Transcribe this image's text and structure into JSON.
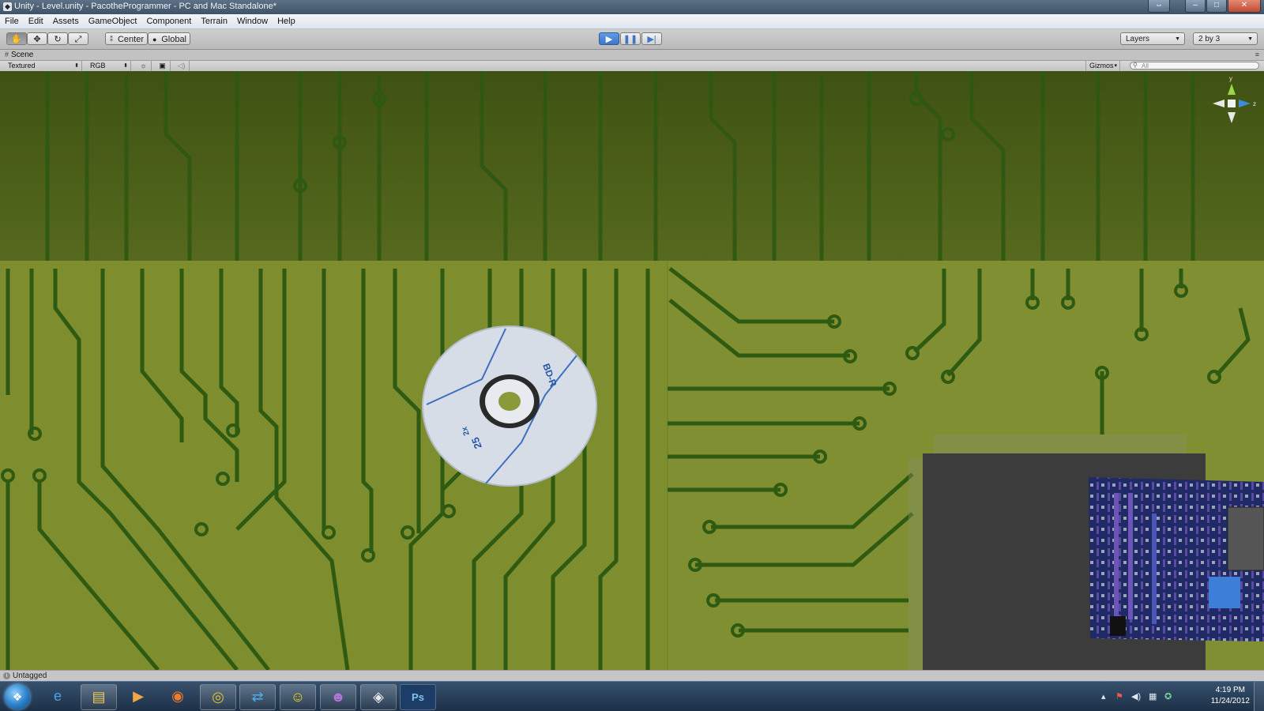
{
  "window": {
    "title": "Unity - Level.unity - PacotheProgrammer - PC and Mac Standalone*",
    "controls": [
      "restore-down",
      "minimize",
      "maximize",
      "close"
    ]
  },
  "menu": {
    "items": [
      "File",
      "Edit",
      "Assets",
      "GameObject",
      "Component",
      "Terrain",
      "Window",
      "Help"
    ]
  },
  "toolbar": {
    "tools": [
      "hand-icon",
      "move-icon",
      "rotate-icon",
      "scale-icon"
    ],
    "pivot_center": "Center",
    "pivot_global": "Global",
    "playback": [
      "play-icon",
      "pause-icon",
      "step-icon"
    ],
    "layers_label": "Layers",
    "layout_label": "2 by 3"
  },
  "scene": {
    "tab_label": "Scene",
    "render_mode": "Textured",
    "color_mode": "RGB",
    "gizmos_label": "Gizmos",
    "search_placeholder": "All",
    "gizmo_axes": {
      "y": "y",
      "z": "z"
    },
    "disc_text": {
      "type": "BD-R",
      "capacity": "25",
      "speed": "2x"
    }
  },
  "status": {
    "text": "Untagged"
  },
  "taskbar": {
    "apps": [
      "windows-start",
      "internet-explorer",
      "file-explorer",
      "media-player",
      "firefox",
      "chrome",
      "teamviewer",
      "aim",
      "yahoo-messenger",
      "unity",
      "photoshop"
    ],
    "photoshop_label": "Ps",
    "clock_time": "4:19 PM",
    "clock_date": "11/24/2012"
  },
  "colors": {
    "pcb_dark": "#4d5e1a",
    "pcb_light": "#7f8f30",
    "trace": "#2f5a12",
    "chip": "#3c3c3c",
    "play_accent": "#3e76c4",
    "disc": "#d6dde6"
  }
}
